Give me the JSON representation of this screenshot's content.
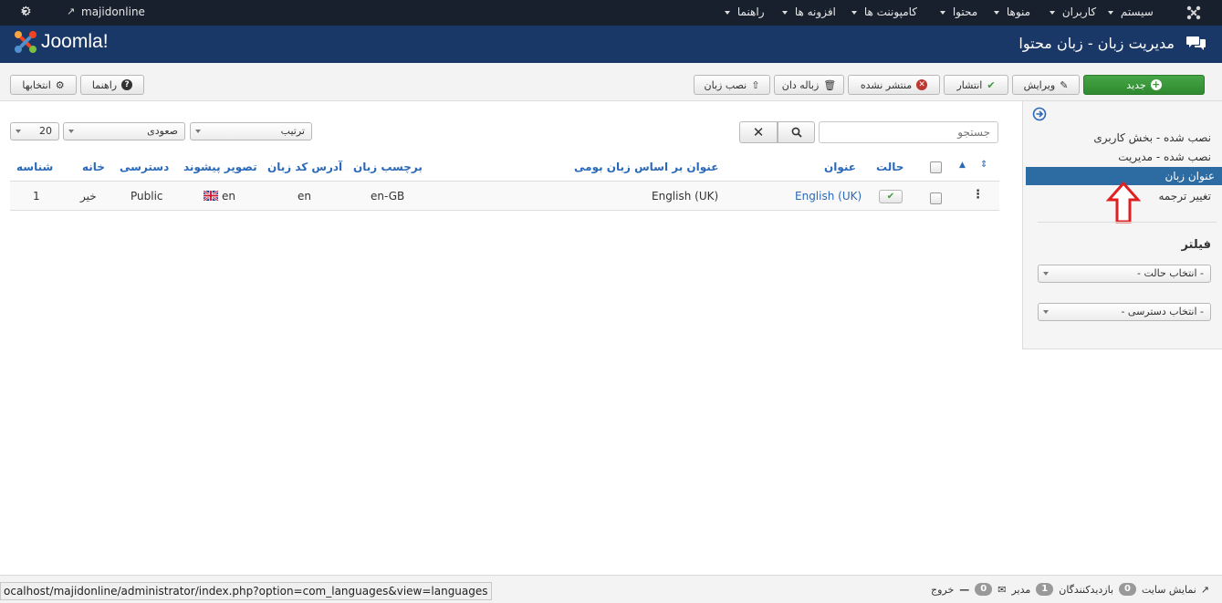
{
  "navbar": {
    "site_name": "majidonline",
    "menus": [
      {
        "label": "سیستم"
      },
      {
        "label": "کاربران"
      },
      {
        "label": "منوها"
      },
      {
        "label": "محتوا"
      },
      {
        "label": "کامپوننت ها"
      },
      {
        "label": "افزونه ها"
      },
      {
        "label": "راهنما"
      }
    ]
  },
  "header": {
    "logo_text": "Joomla!",
    "title": "مدیریت زبان - زبان محتوا"
  },
  "toolbar": {
    "new": "جدید",
    "edit": "ویرایش",
    "publish": "انتشار",
    "unpublish": "منتشر نشده",
    "trash": "زباله دان",
    "install": "نصب زبان",
    "help": "راهنما",
    "options": "انتخابها"
  },
  "sidebar": {
    "items": [
      {
        "label": "نصب شده - بخش کاربری"
      },
      {
        "label": "نصب شده - مدیریت"
      },
      {
        "label": "عنوان زبان"
      },
      {
        "label": "تغییر ترجمه"
      }
    ],
    "filter_title": "فیلتر",
    "filters": [
      {
        "label": "- انتخاب حالت -"
      },
      {
        "label": "- انتخاب دسترسی -"
      }
    ]
  },
  "search": {
    "placeholder": "جستجو"
  },
  "list_controls": {
    "ordering": "ترتیب",
    "direction": "صعودی",
    "limit": "20"
  },
  "table": {
    "headers": {
      "status": "حالت",
      "title": "عنوان",
      "native_title": "عنوان بر اساس زبان بومی",
      "lang_tag": "برچسب زبان",
      "url_code": "آدرس کد زبان",
      "image_prefix": "تصویر پیشوند",
      "access": "دسترسی",
      "home": "خانه",
      "id": "شناسه"
    },
    "rows": [
      {
        "title": "English (UK)",
        "native_title": "English (UK)",
        "lang_tag": "en-GB",
        "url_code": "en",
        "image_prefix": "en",
        "access": "Public",
        "home": "خیر",
        "id": "1"
      }
    ]
  },
  "statusbar": {
    "view_site": "نمایش سایت",
    "visitors_count": "0",
    "visitors_label": "بازدیدکنندگان",
    "admins_count": "1",
    "admins_label": "مدیر",
    "messages_count": "0",
    "logout": "خروج",
    "url": "ocalhost/majidonline/administrator/index.php?option=com_languages&view=languages"
  },
  "colors": {
    "navbar_bg": "#17202c",
    "header_bg": "#1a3867",
    "active_sidebar": "#2d6ca2",
    "link_blue": "#2a69b8",
    "green_button": "#3a993a",
    "arrow_red": "#e02020"
  }
}
